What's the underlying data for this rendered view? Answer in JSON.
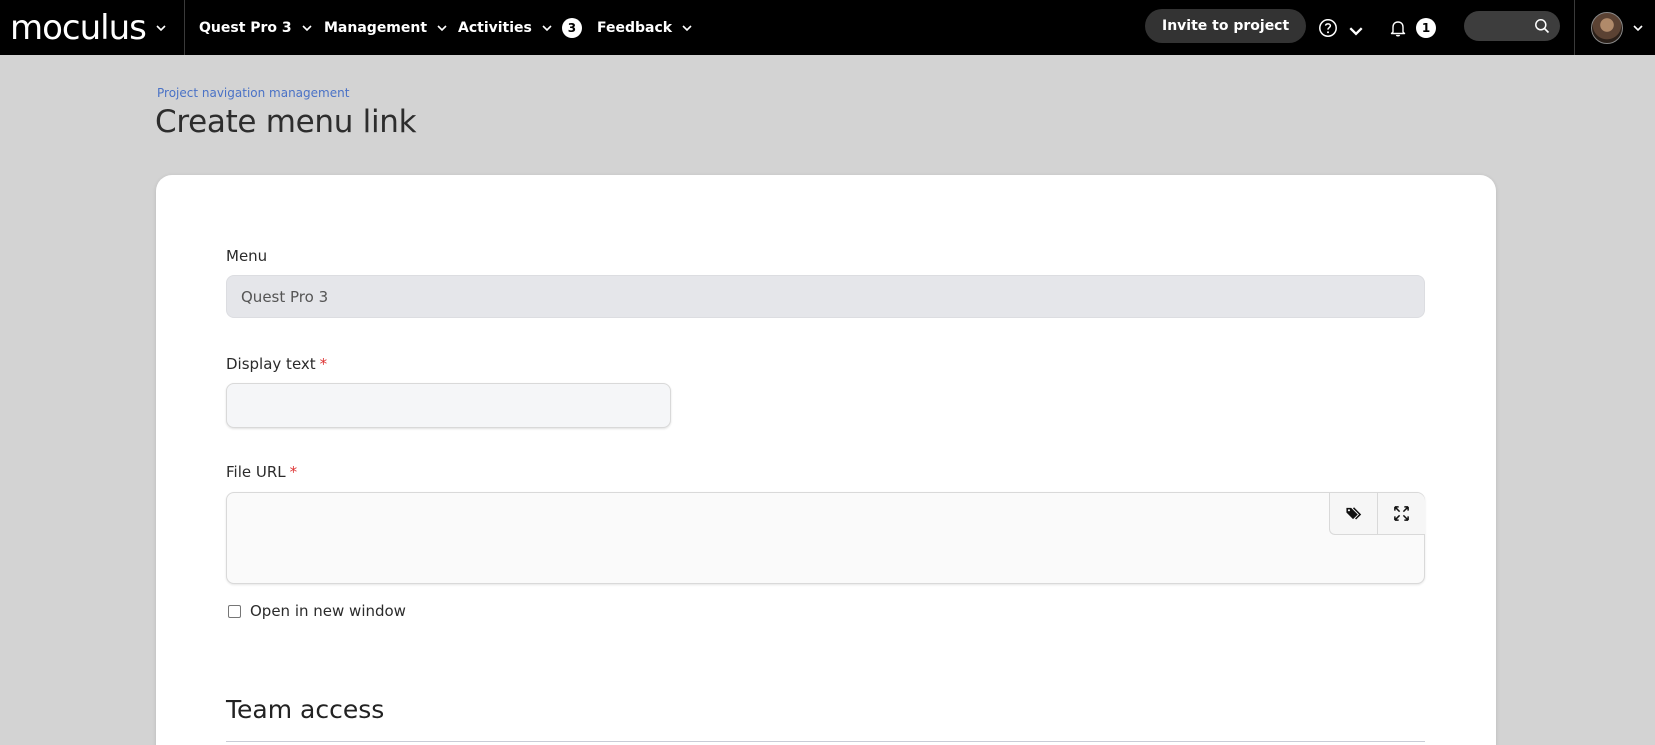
{
  "brand": {
    "name": "moculus"
  },
  "nav": {
    "project": "Quest Pro 3",
    "management": "Management",
    "activities": "Activities",
    "activities_count": "3",
    "feedback": "Feedback",
    "invite": "Invite to project",
    "notifications_count": "1"
  },
  "header": {
    "breadcrumb": "Project navigation management",
    "title": "Create menu link"
  },
  "form": {
    "menu_label": "Menu",
    "menu_value": "Quest Pro 3",
    "display_label": "Display text",
    "display_value": "",
    "url_label": "File URL",
    "url_value": "",
    "required_mark": "*",
    "open_new_window_label": "Open in new window",
    "open_new_window_checked": false
  },
  "section": {
    "team_access_title": "Team access"
  },
  "icons": {
    "chevron": "chevron-down-icon",
    "help": "help-circle-icon",
    "bell": "bell-icon",
    "search": "search-icon",
    "tags": "tags-icon",
    "expand": "expand-icon"
  },
  "colors": {
    "topbar": "#000000",
    "background": "#d3d3d3",
    "link": "#4a72c6",
    "required": "#dd3333"
  }
}
